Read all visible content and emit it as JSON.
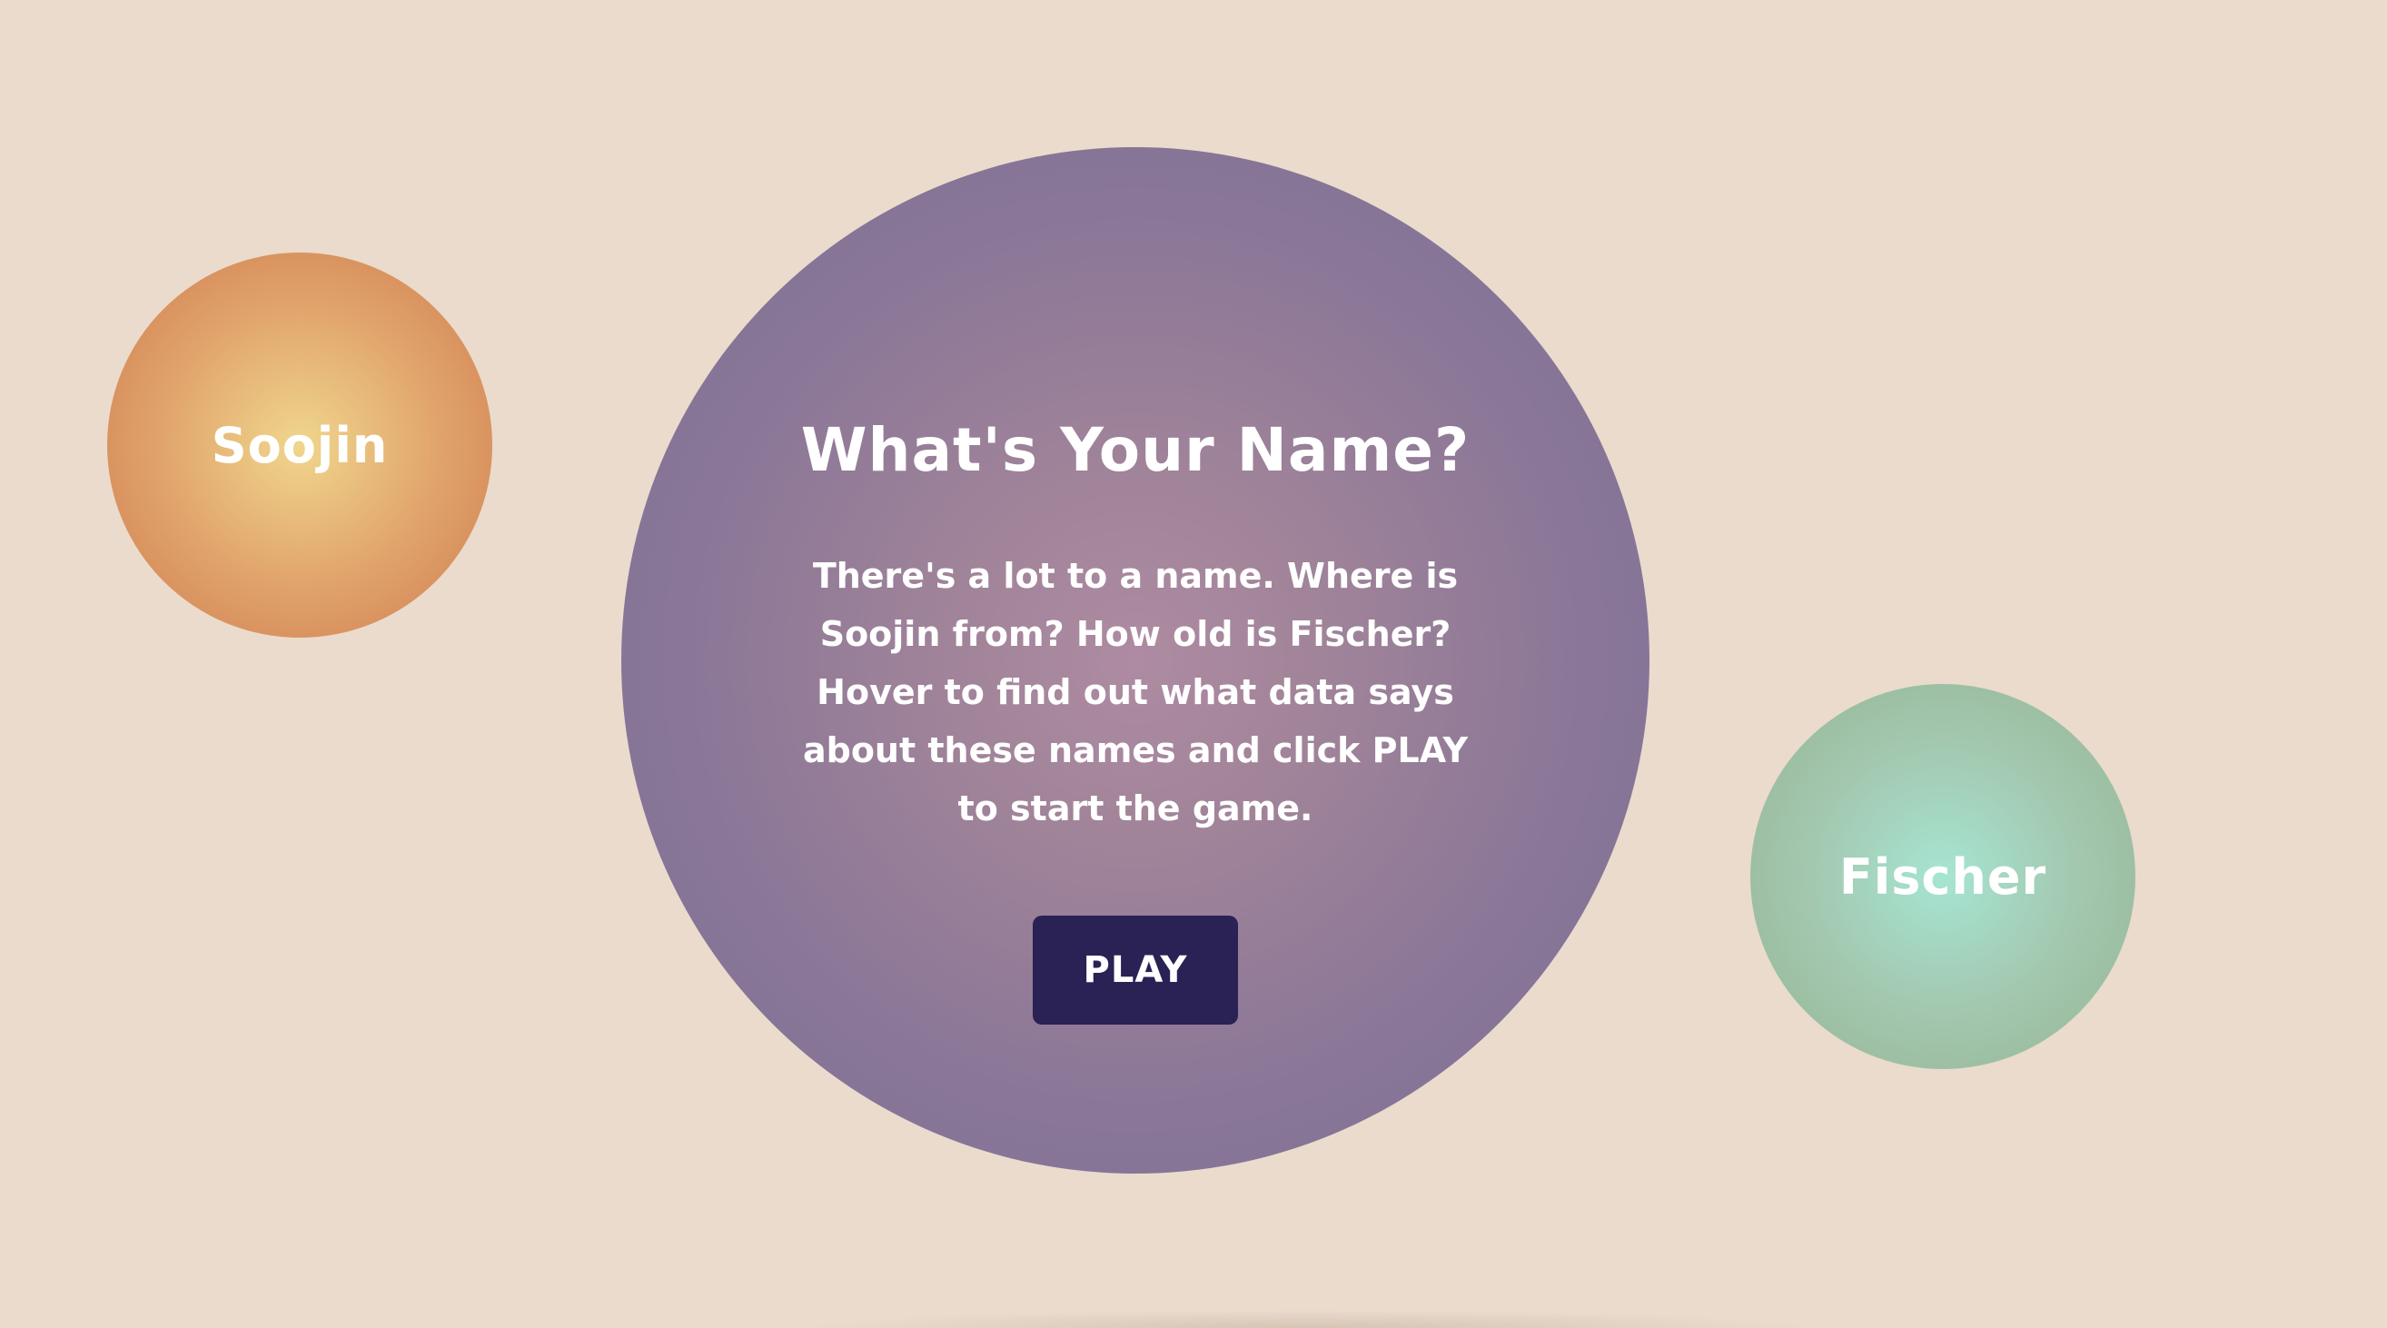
{
  "intro": {
    "title": "What's Your Name?",
    "description": "There's a lot to a name. Where is Soojin from? How old is Fischer? Hover to find out what data says about these names and click PLAY to start the game.",
    "play_label": "PLAY"
  },
  "names": [
    {
      "label": "Soojin",
      "color": "#cf7a4f"
    },
    {
      "label": "Fischer",
      "color": "#94b593"
    }
  ],
  "colors": {
    "background": "#eadbcd",
    "main_circle": "#786f95",
    "play_button": "#2a2154"
  }
}
